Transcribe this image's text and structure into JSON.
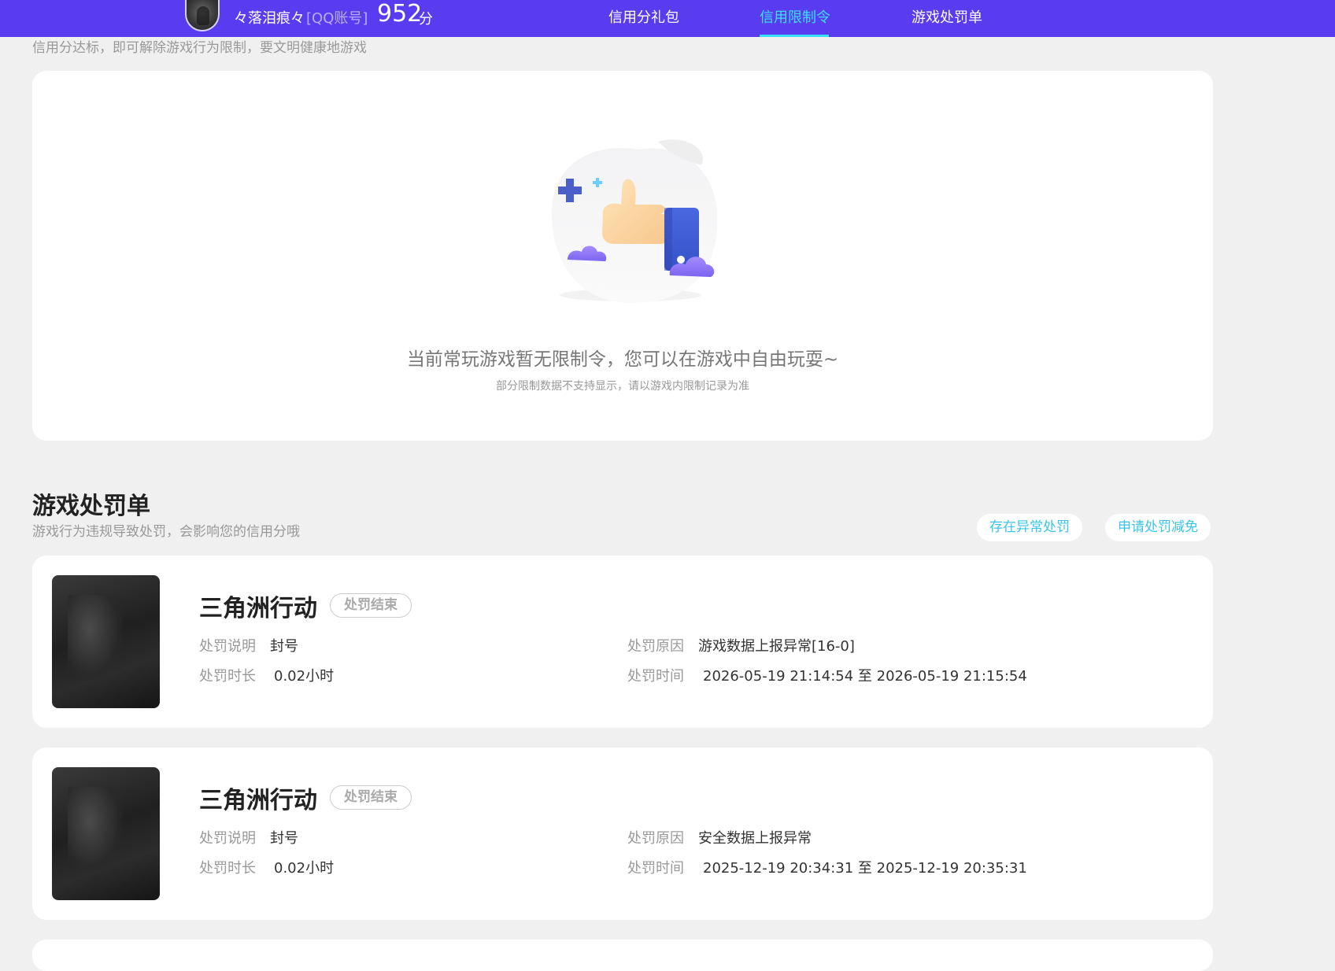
{
  "header": {
    "user_name": "々落泪痕々",
    "account_type": "[QQ账号]",
    "score": "952",
    "score_unit": "分",
    "tabs": [
      {
        "label": "信用分礼包",
        "active": false
      },
      {
        "label": "信用限制令",
        "active": true
      },
      {
        "label": "游戏处罚单",
        "active": false
      }
    ],
    "accent_color": "#5a3cf0",
    "active_color": "#38e0ff"
  },
  "restriction": {
    "description": "信用分达标，即可解除游戏行为限制，要文明健康地游戏",
    "empty_title": "当前常玩游戏暂无限制令，您可以在游戏中自由玩耍~",
    "empty_subtitle": "部分限制数据不支持显示，请以游戏内限制记录为准",
    "illustration_icon": "thumbs-up-icon"
  },
  "penalties": {
    "title": "游戏处罚单",
    "description": "游戏行为违规导致处罚，会影响您的信用分哦",
    "abnormal_button": "存在异常处罚",
    "appeal_button": "申请处罚减免",
    "labels": {
      "note": "处罚说明",
      "duration": "处罚时长",
      "reason": "处罚原因",
      "time": "处罚时间"
    },
    "items": [
      {
        "game": "三角洲行动",
        "status": "处罚结束",
        "note": "封号",
        "duration": "0.02小时",
        "reason": "游戏数据上报异常[16-0]",
        "time": "2026-05-19 21:14:54 至 2026-05-19 21:15:54"
      },
      {
        "game": "三角洲行动",
        "status": "处罚结束",
        "note": "封号",
        "duration": "0.02小时",
        "reason": "安全数据上报异常",
        "time": "2025-12-19 20:34:31 至 2025-12-19 20:35:31"
      }
    ]
  }
}
